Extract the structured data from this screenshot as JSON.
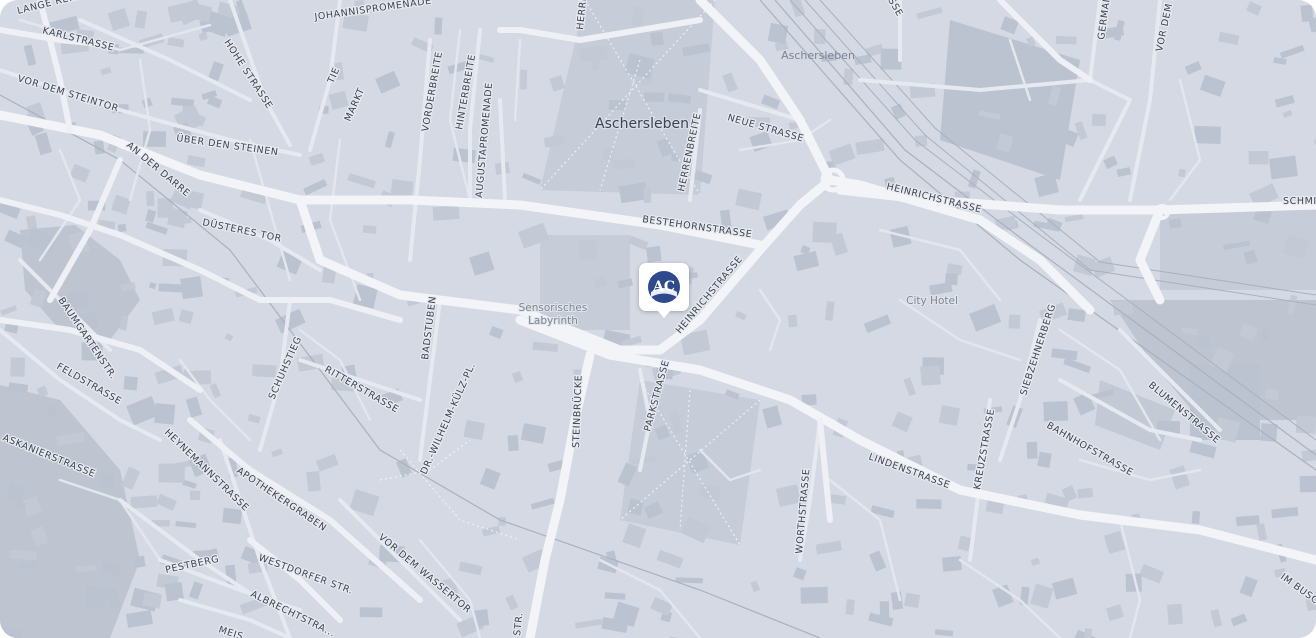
{
  "map": {
    "town_label": "Aschersleben",
    "station_label": "Aschersleben",
    "poi": {
      "labyrinth_line1": "Sensorisches",
      "labyrinth_line2": "Labyrinth",
      "hotel": "City Hotel"
    },
    "streets": {
      "lange": "LANGE RE...",
      "karlstrasse": "KARLSTRASSE",
      "johannispromenade": "JOHANNISPROMENADE",
      "herreni": "HERREN",
      "hohe": "HOHE STRASSE",
      "tie": "TIE",
      "vor_steintor": "VOR DEM STEINTOR",
      "markt": "MARKT",
      "vorderbreite": "VORDERBREITE",
      "hinterbreite": "HINTERBREITE",
      "augustapromenade": "AUGUSTAPROMENADE",
      "herrenbreite": "HERRENBREITE",
      "neue": "NEUE STRASSE",
      "ueber_steinen": "ÜBER DEN STEINEN",
      "an_der_darre": "AN DER DARRE",
      "heinrich_e": "HEINRICHSTRASSE",
      "bestehorn": "BESTEHORNSTRASSE",
      "duesteres": "DÜSTERES TOR",
      "heinrich_w": "HEINRICHSTRASSE",
      "baumgarten": "BAUMGARTENSTR.",
      "badstuben": "BADSTUBEN",
      "schuhstieg": "SCHUHSTIEG",
      "feldstrasse": "FELDSTRASSE",
      "ritterstrasse": "RITTERSTRASSE",
      "siebzehnerberg": "SIEBZEHNERBERG",
      "blumenstrasse": "BLUMENSTRASSE",
      "parkstrasse": "PARKSTRASSE",
      "steinbruecke": "STEINBRÜCKE",
      "koelz": "DR.-WILHELM-KÜLZ-PL.",
      "heynemann": "HEYNEMANNSTRASSE",
      "askanier": "ASKANIERSTRASSE",
      "apothekergraben": "APOTHEKERGRABEN",
      "kreuzstrasse": "KREUZSTRASSE",
      "bahnhofstrasse": "BAHNHOFSTRASSE",
      "lindenstrasse": "LINDENSTRASSE",
      "worthstrasse": "WORTHSTRASSE",
      "vor_wassertor": "VOR DEM WASSERTOR",
      "westdorfer": "WESTDORFER STR.",
      "pestberg": "PESTBERG",
      "albrecht": "ALBRECHTSTRA...",
      "meis": "MEIS...",
      "str_bottom": "STR.",
      "im_busch": "IM BUSCH",
      "schmi": "SCHMI...",
      "german": "GERMAN...",
      "vor_dem_f": "VOR DEM F...",
      "sse": "SSE"
    }
  },
  "marker": {
    "label": "AC",
    "color": "#2e4a8c"
  }
}
